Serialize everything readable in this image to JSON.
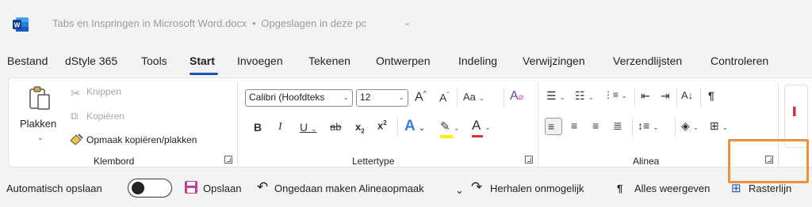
{
  "title": {
    "document": "Tabs en Inspringen in Microsoft Word.docx",
    "separator": "•",
    "status": "Opgeslagen in deze pc",
    "chevron": "⌄"
  },
  "tabs": [
    {
      "label": "Bestand",
      "active": false
    },
    {
      "label": "dStyle 365",
      "active": false
    },
    {
      "label": "Tools",
      "active": false
    },
    {
      "label": "Start",
      "active": true
    },
    {
      "label": "Invoegen",
      "active": false
    },
    {
      "label": "Tekenen",
      "active": false
    },
    {
      "label": "Ontwerpen",
      "active": false
    },
    {
      "label": "Indeling",
      "active": false
    },
    {
      "label": "Verwijzingen",
      "active": false
    },
    {
      "label": "Verzendlijsten",
      "active": false
    },
    {
      "label": "Controleren",
      "active": false
    }
  ],
  "clipboard": {
    "group_label": "Klembord",
    "paste": "Plakken",
    "cut": "Knippen",
    "copy": "Kopiëren",
    "format_painter": "Opmaak kopiëren/plakken"
  },
  "font": {
    "group_label": "Lettertype",
    "font_name": "Calibri (Hoofdteks",
    "font_size": "12"
  },
  "paragraph": {
    "group_label": "Alinea"
  },
  "qat": {
    "autosave_label": "Automatisch opslaan",
    "autosave_on": false,
    "save": "Opslaan",
    "undo": "Ongedaan maken Alineaopmaak",
    "redo": "Herhalen onmogelijk",
    "show_all": "Alles weergeven",
    "gridlines": "Rasterlijn"
  },
  "colors": {
    "accent": "#185abd",
    "highlight": "#f1903a",
    "font_color": "#d13438",
    "highlighter": "#fff100"
  }
}
